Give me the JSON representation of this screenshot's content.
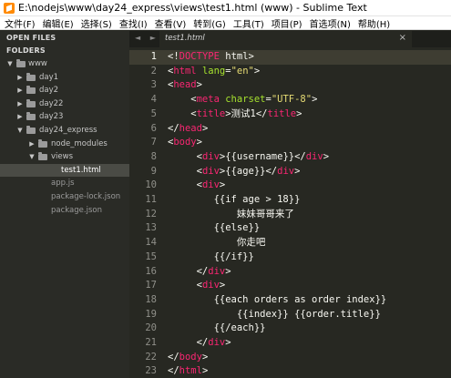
{
  "window": {
    "title": "E:\\nodejs\\www\\day24_express\\views\\test1.html (www) - Sublime Text"
  },
  "menu": [
    "文件(F)",
    "编辑(E)",
    "选择(S)",
    "查找(I)",
    "查看(V)",
    "转到(G)",
    "工具(T)",
    "项目(P)",
    "首选项(N)",
    "帮助(H)"
  ],
  "sidebar": {
    "open_files_label": "OPEN FILES",
    "folders_label": "FOLDERS",
    "items": [
      {
        "label": "www",
        "type": "folder",
        "expanded": true
      },
      {
        "label": "day1",
        "type": "folder",
        "expanded": false
      },
      {
        "label": "day2",
        "type": "folder",
        "expanded": false
      },
      {
        "label": "day22",
        "type": "folder",
        "expanded": false
      },
      {
        "label": "day23",
        "type": "folder",
        "expanded": false
      },
      {
        "label": "day24_express",
        "type": "folder",
        "expanded": true
      },
      {
        "label": "node_modules",
        "type": "folder",
        "expanded": false
      },
      {
        "label": "views",
        "type": "folder",
        "expanded": true
      },
      {
        "label": "test1.html",
        "type": "file",
        "selected": true
      },
      {
        "label": "app.js",
        "type": "file"
      },
      {
        "label": "package-lock.json",
        "type": "file"
      },
      {
        "label": "package.json",
        "type": "file"
      }
    ]
  },
  "tabs": {
    "nav": "◄ ►",
    "active": "test1.html",
    "close": "×"
  },
  "editor": {
    "current_line": 1,
    "lines": [
      "<!DOCTYPE html>",
      "<html lang=\"en\">",
      "<head>",
      "    <meta charset=\"UTF-8\">",
      "    <title>测试1</title>",
      "</head>",
      "<body>",
      "     <div>{{username}}</div>",
      "     <div>{{age}}</div>",
      "     <div>",
      "        {{if age > 18}}",
      "            妹妹哥哥来了",
      "        {{else}}",
      "            你走吧",
      "        {{/if}}",
      "     </div>",
      "     <div>",
      "        {{each orders as order index}}",
      "            {{index}} {{order.title}}",
      "        {{/each}}",
      "     </div>",
      "</body>",
      "</html>"
    ]
  },
  "colors": {
    "background": "#272822",
    "tag": "#f92672",
    "attribute": "#a6e22e",
    "string": "#e6db74",
    "text": "#f8f8f2",
    "line_number": "#90908a"
  }
}
